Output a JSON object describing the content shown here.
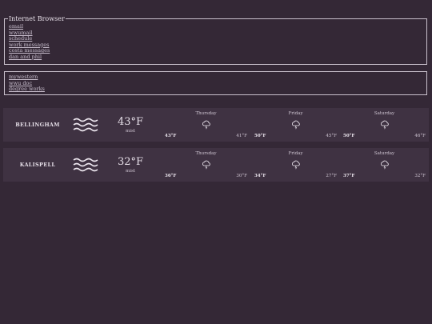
{
  "browser": {
    "legend": "Internet Browser",
    "links": [
      "email",
      "wwumail",
      "schedule",
      "work messages",
      "costa messages",
      "dan and phil"
    ]
  },
  "links2": {
    "links": [
      "mywestern",
      "wwu doc",
      "degree works"
    ]
  },
  "weather": [
    {
      "city": "BELLINGHAM",
      "condition_icon": "mist-icon",
      "temp": "43°F",
      "condition": "mist",
      "days": [
        {
          "name": "Thursday",
          "icon": "rain-cloud-icon",
          "high": "43°F",
          "low": "41°F"
        },
        {
          "name": "Friday",
          "icon": "rain-cloud-icon",
          "high": "50°F",
          "low": "45°F"
        },
        {
          "name": "Saturday",
          "icon": "rain-cloud-icon",
          "high": "50°F",
          "low": "46°F"
        }
      ]
    },
    {
      "city": "KALISPELL",
      "condition_icon": "mist-icon",
      "temp": "32°F",
      "condition": "mist",
      "days": [
        {
          "name": "Thursday",
          "icon": "rain-cloud-icon",
          "high": "36°F",
          "low": "30°F"
        },
        {
          "name": "Friday",
          "icon": "rain-cloud-icon",
          "high": "34°F",
          "low": "27°F"
        },
        {
          "name": "Saturday",
          "icon": "rain-cloud-icon",
          "high": "37°F",
          "low": "32°F"
        }
      ]
    }
  ]
}
